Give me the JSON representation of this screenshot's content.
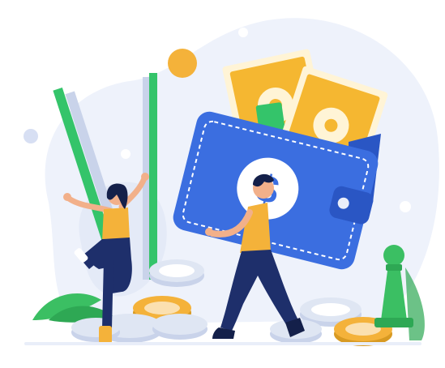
{
  "illustration": {
    "subject": "money-wallet-celebration",
    "colors": {
      "blob_background": "#e9eef9",
      "wallet_blue": "#3b6ee0",
      "wallet_dark": "#2a56c4",
      "cash_gold": "#f5b731",
      "cash_cream": "#fff4d6",
      "coin_gray": "#dfe6f3",
      "coin_gold": "#f4b23a",
      "bar_green": "#34c46a",
      "plant_green": "#3bbf63",
      "navy": "#1e2f6b",
      "skin": "#f2b08a",
      "shirt_orange": "#f4b23a",
      "hair": "#14204a"
    },
    "icon_names": [
      "dollar-sign-icon",
      "chess-pawn-icon",
      "leaf-icon"
    ]
  }
}
